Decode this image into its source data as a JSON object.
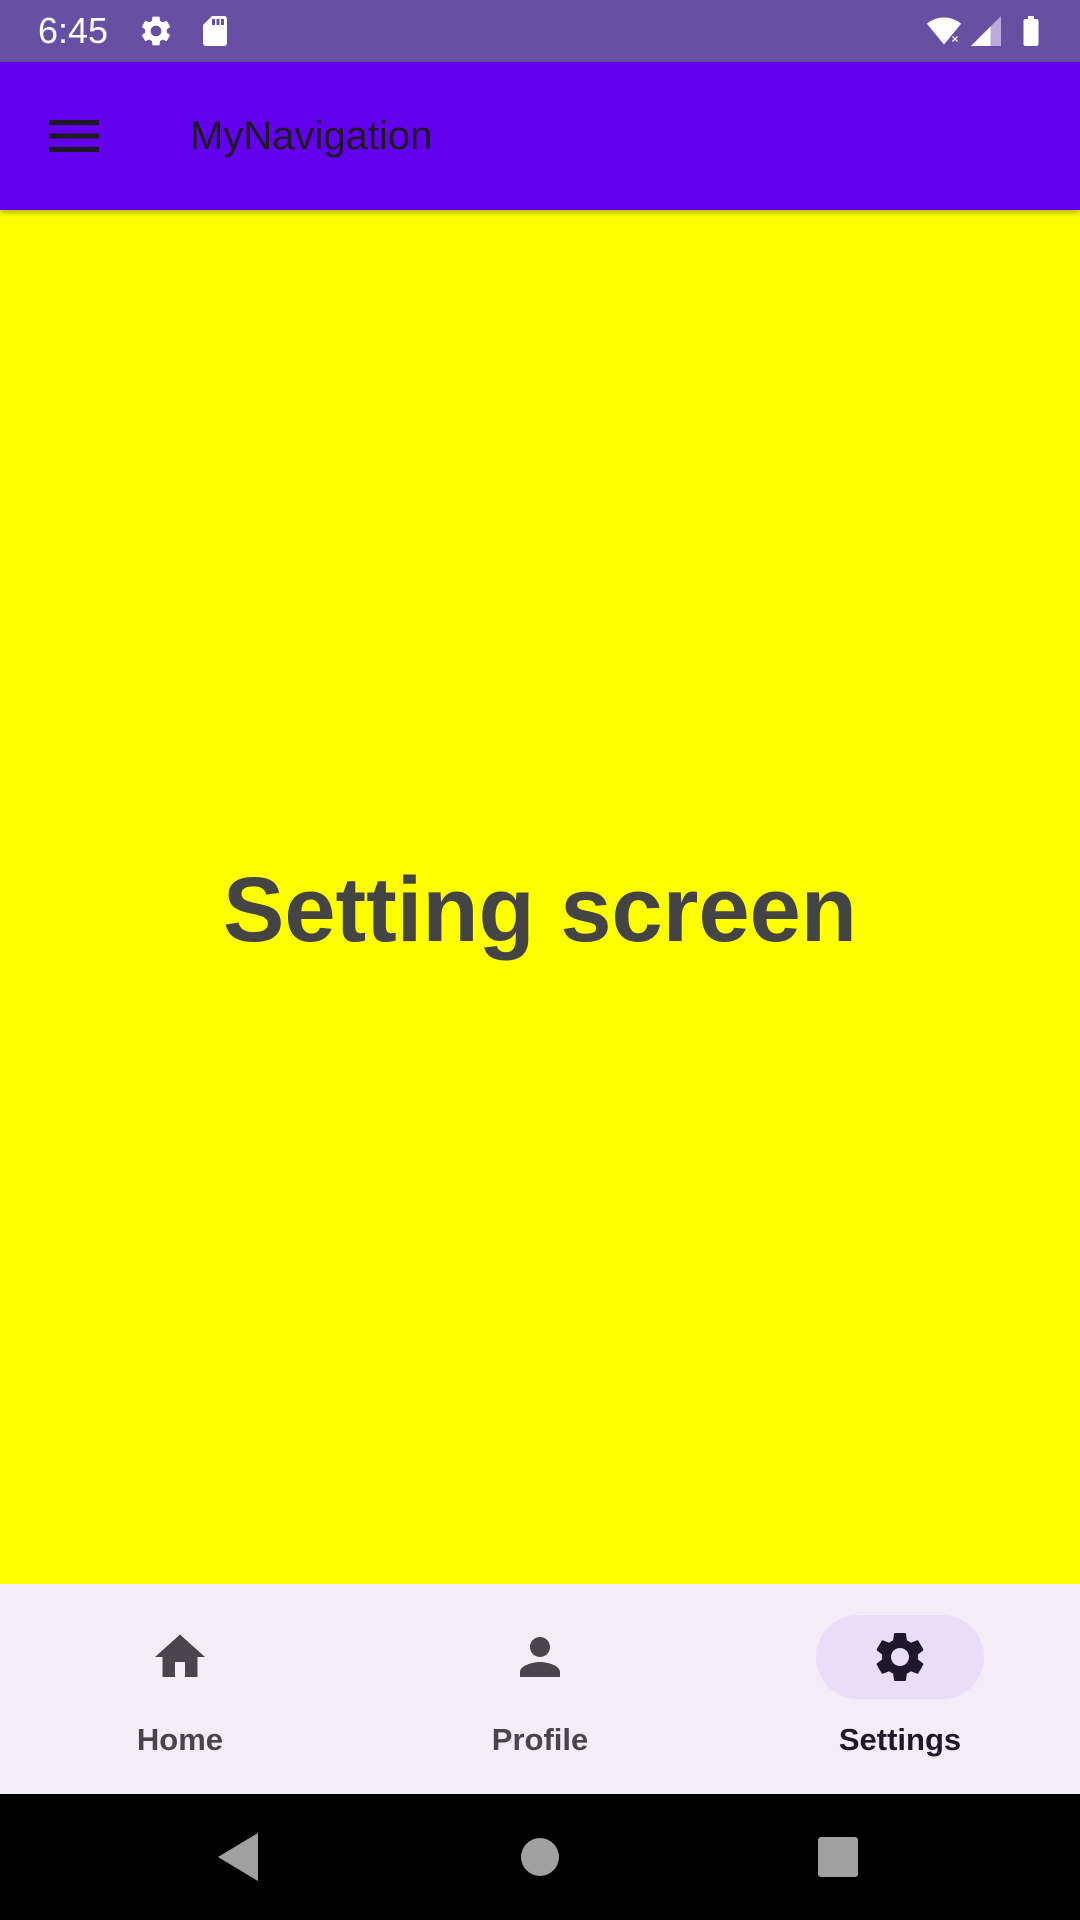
{
  "status_bar": {
    "time": "6:45",
    "left_icons": [
      "gear-icon",
      "sd-card-icon"
    ],
    "right_icons": [
      "wifi-icon",
      "signal-icon",
      "battery-icon"
    ],
    "background": "#6750A4"
  },
  "app_bar": {
    "title": "MyNavigation",
    "nav_icon": "hamburger-menu-icon",
    "background": "#6200EE"
  },
  "content": {
    "label": "Setting screen",
    "background": "#FFFF00"
  },
  "bottom_nav": {
    "items": [
      {
        "label": "Home",
        "icon": "home-icon",
        "selected": false
      },
      {
        "label": "Profile",
        "icon": "person-icon",
        "selected": false
      },
      {
        "label": "Settings",
        "icon": "settings-gear-icon",
        "selected": true
      }
    ],
    "background": "#F3EDF7",
    "indicator_color": "#E8DEF8"
  },
  "system_nav": {
    "buttons": [
      "back-icon",
      "home-circle-icon",
      "recents-icon"
    ]
  }
}
